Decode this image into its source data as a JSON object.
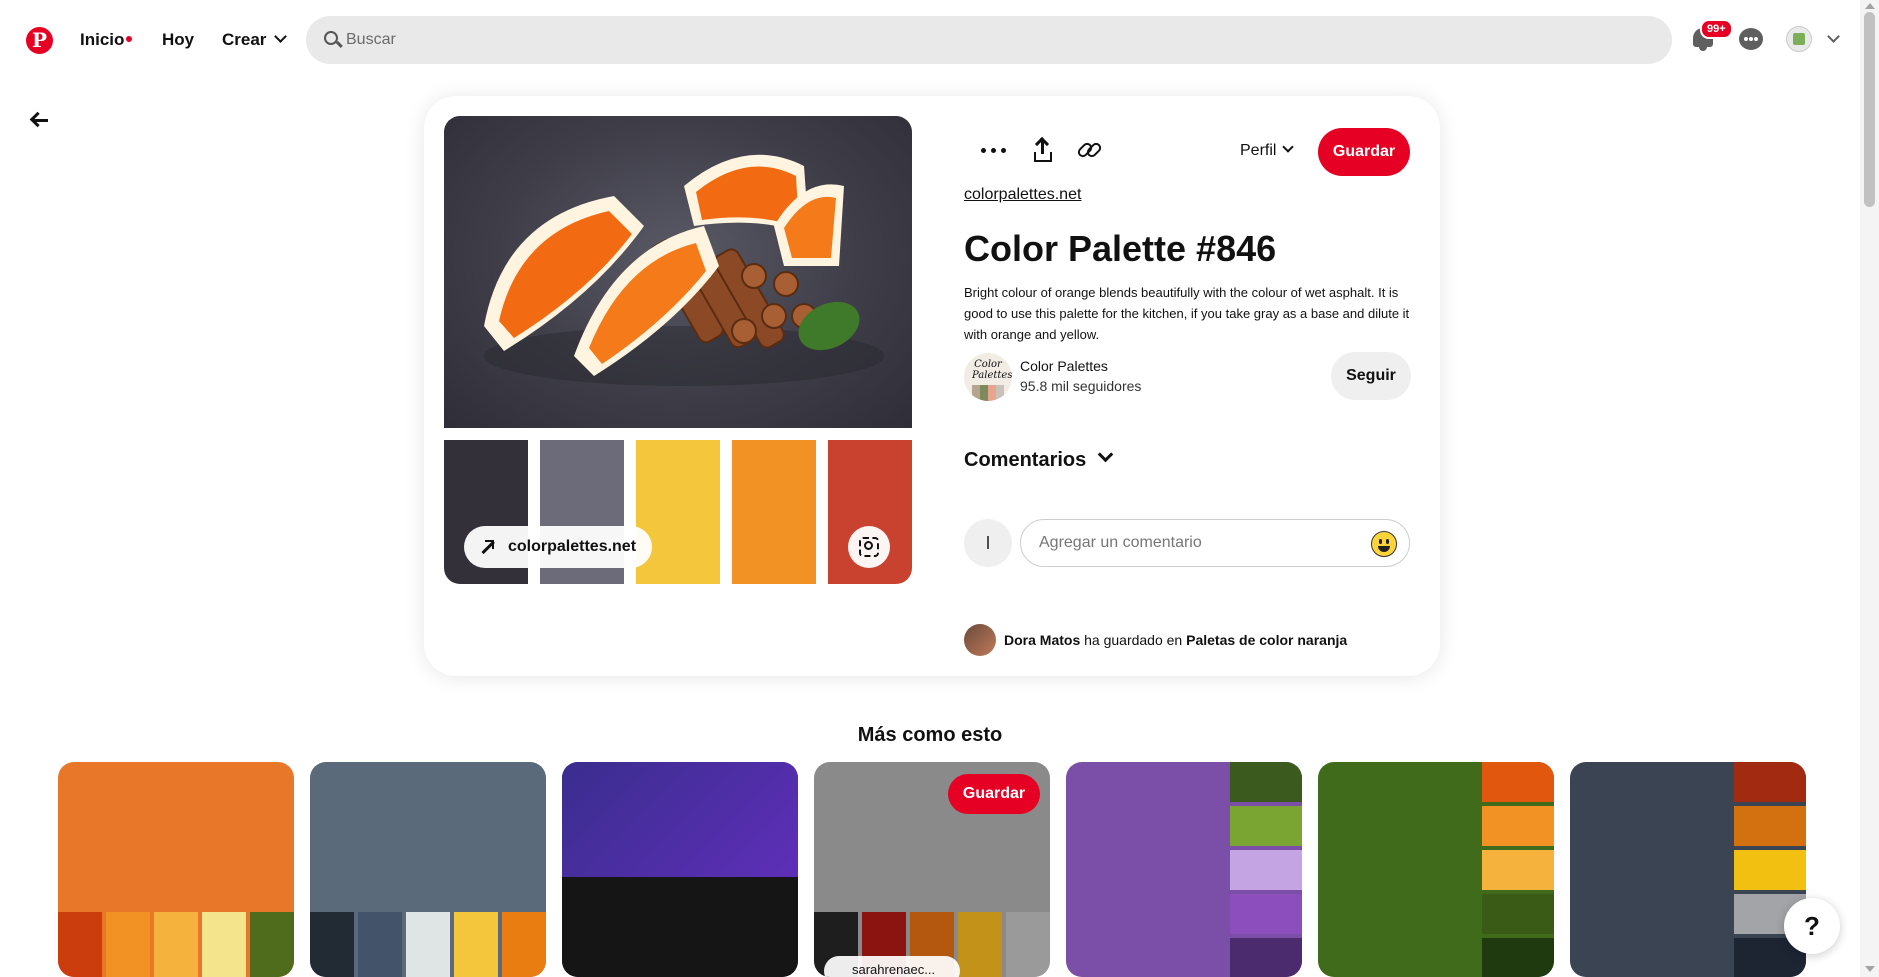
{
  "nav": {
    "logo": "P",
    "home_label": "Inicio",
    "today_label": "Hoy",
    "create_label": "Crear",
    "notifications_badge": "99+"
  },
  "search": {
    "placeholder": "Buscar"
  },
  "pin": {
    "image_link_label": "colorpalettes.net",
    "palette_colors": [
      "#33303a",
      "#6c6b7a",
      "#f3c63c",
      "#f39224",
      "#c9412f"
    ],
    "profile_select": "Perfil",
    "save_label": "Guardar",
    "source_link": "colorpalettes.net",
    "title": "Color Palette #846",
    "description": "Bright colour of orange blends beautifully with the colour of wet asphalt. It is good to use this palette for the kitchen, if you take gray as a base and dilute it with orange and yellow.",
    "creator": {
      "avatar_text": "Color Palettes",
      "name": "Color Palettes",
      "followers": "95.8 mil seguidores",
      "follow_label": "Seguir"
    },
    "comments": {
      "heading": "Comentarios",
      "user_initial": "I",
      "placeholder": "Agregar un comentario"
    },
    "saved_by": {
      "user": "Dora Matos",
      "action": "ha guardado en",
      "board": "Paletas de color naranja"
    }
  },
  "more": {
    "title": "Más como esto",
    "tiles": [
      {
        "bg": "#e8772a",
        "swatches": [
          "#cc3d0e",
          "#f39224",
          "#f5b23c",
          "#f4e58d",
          "#4f6b1c"
        ]
      },
      {
        "bg": "#5a6a7a",
        "swatches": [
          "#222a33",
          "#43546a",
          "#dfe4e5",
          "#f3c63c",
          "#e97d12"
        ]
      },
      {
        "bg": "#2e2a6a",
        "swatches": []
      },
      {
        "bg": "#8a8a8a",
        "swatches": [
          "#1e1e1e",
          "#8b1410",
          "#b5580f",
          "#c29219",
          "#9a9a9a"
        ],
        "save_label": "Guardar",
        "link_label": "sarahrenaec..."
      },
      {
        "bg": "#7b4ea8",
        "swatches": [
          "#3b5b1e",
          "#7aa533",
          "#c5a4e3",
          "#8b4ebc",
          "#4c2a6e"
        ]
      },
      {
        "bg": "#3f6b1a",
        "swatches": [
          "#e2570e",
          "#f39224",
          "#f5b23c",
          "#395b16",
          "#1e3a0e"
        ]
      },
      {
        "bg": "#3a4452",
        "swatches": [
          "#a12a10",
          "#d37010",
          "#f1c011",
          "#a3a4a7",
          "#1d2533"
        ]
      }
    ]
  },
  "help_label": "?"
}
